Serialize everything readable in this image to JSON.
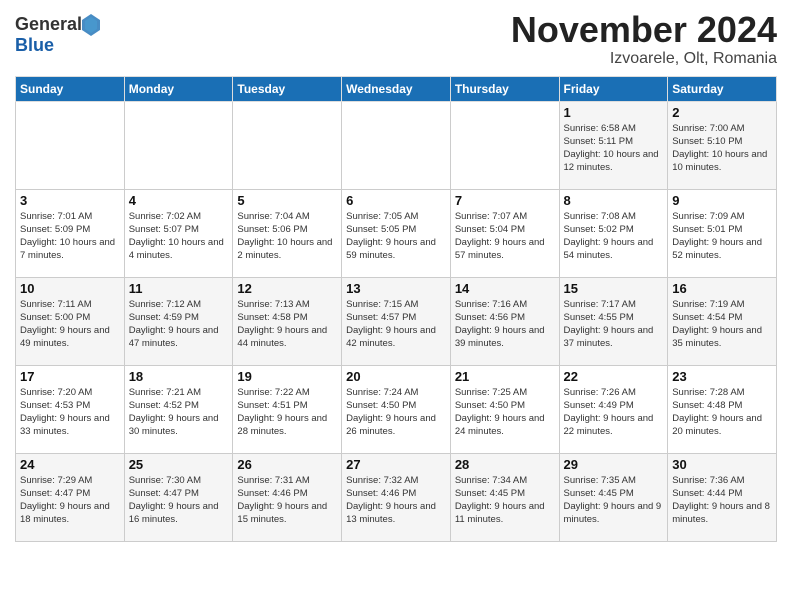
{
  "header": {
    "logo_line1": "General",
    "logo_line2": "Blue",
    "month": "November 2024",
    "location": "Izvoarele, Olt, Romania"
  },
  "weekdays": [
    "Sunday",
    "Monday",
    "Tuesday",
    "Wednesday",
    "Thursday",
    "Friday",
    "Saturday"
  ],
  "weeks": [
    [
      {
        "day": "",
        "info": ""
      },
      {
        "day": "",
        "info": ""
      },
      {
        "day": "",
        "info": ""
      },
      {
        "day": "",
        "info": ""
      },
      {
        "day": "",
        "info": ""
      },
      {
        "day": "1",
        "info": "Sunrise: 6:58 AM\nSunset: 5:11 PM\nDaylight: 10 hours\nand 12 minutes."
      },
      {
        "day": "2",
        "info": "Sunrise: 7:00 AM\nSunset: 5:10 PM\nDaylight: 10 hours\nand 10 minutes."
      }
    ],
    [
      {
        "day": "3",
        "info": "Sunrise: 7:01 AM\nSunset: 5:09 PM\nDaylight: 10 hours\nand 7 minutes."
      },
      {
        "day": "4",
        "info": "Sunrise: 7:02 AM\nSunset: 5:07 PM\nDaylight: 10 hours\nand 4 minutes."
      },
      {
        "day": "5",
        "info": "Sunrise: 7:04 AM\nSunset: 5:06 PM\nDaylight: 10 hours\nand 2 minutes."
      },
      {
        "day": "6",
        "info": "Sunrise: 7:05 AM\nSunset: 5:05 PM\nDaylight: 9 hours\nand 59 minutes."
      },
      {
        "day": "7",
        "info": "Sunrise: 7:07 AM\nSunset: 5:04 PM\nDaylight: 9 hours\nand 57 minutes."
      },
      {
        "day": "8",
        "info": "Sunrise: 7:08 AM\nSunset: 5:02 PM\nDaylight: 9 hours\nand 54 minutes."
      },
      {
        "day": "9",
        "info": "Sunrise: 7:09 AM\nSunset: 5:01 PM\nDaylight: 9 hours\nand 52 minutes."
      }
    ],
    [
      {
        "day": "10",
        "info": "Sunrise: 7:11 AM\nSunset: 5:00 PM\nDaylight: 9 hours\nand 49 minutes."
      },
      {
        "day": "11",
        "info": "Sunrise: 7:12 AM\nSunset: 4:59 PM\nDaylight: 9 hours\nand 47 minutes."
      },
      {
        "day": "12",
        "info": "Sunrise: 7:13 AM\nSunset: 4:58 PM\nDaylight: 9 hours\nand 44 minutes."
      },
      {
        "day": "13",
        "info": "Sunrise: 7:15 AM\nSunset: 4:57 PM\nDaylight: 9 hours\nand 42 minutes."
      },
      {
        "day": "14",
        "info": "Sunrise: 7:16 AM\nSunset: 4:56 PM\nDaylight: 9 hours\nand 39 minutes."
      },
      {
        "day": "15",
        "info": "Sunrise: 7:17 AM\nSunset: 4:55 PM\nDaylight: 9 hours\nand 37 minutes."
      },
      {
        "day": "16",
        "info": "Sunrise: 7:19 AM\nSunset: 4:54 PM\nDaylight: 9 hours\nand 35 minutes."
      }
    ],
    [
      {
        "day": "17",
        "info": "Sunrise: 7:20 AM\nSunset: 4:53 PM\nDaylight: 9 hours\nand 33 minutes."
      },
      {
        "day": "18",
        "info": "Sunrise: 7:21 AM\nSunset: 4:52 PM\nDaylight: 9 hours\nand 30 minutes."
      },
      {
        "day": "19",
        "info": "Sunrise: 7:22 AM\nSunset: 4:51 PM\nDaylight: 9 hours\nand 28 minutes."
      },
      {
        "day": "20",
        "info": "Sunrise: 7:24 AM\nSunset: 4:50 PM\nDaylight: 9 hours\nand 26 minutes."
      },
      {
        "day": "21",
        "info": "Sunrise: 7:25 AM\nSunset: 4:50 PM\nDaylight: 9 hours\nand 24 minutes."
      },
      {
        "day": "22",
        "info": "Sunrise: 7:26 AM\nSunset: 4:49 PM\nDaylight: 9 hours\nand 22 minutes."
      },
      {
        "day": "23",
        "info": "Sunrise: 7:28 AM\nSunset: 4:48 PM\nDaylight: 9 hours\nand 20 minutes."
      }
    ],
    [
      {
        "day": "24",
        "info": "Sunrise: 7:29 AM\nSunset: 4:47 PM\nDaylight: 9 hours\nand 18 minutes."
      },
      {
        "day": "25",
        "info": "Sunrise: 7:30 AM\nSunset: 4:47 PM\nDaylight: 9 hours\nand 16 minutes."
      },
      {
        "day": "26",
        "info": "Sunrise: 7:31 AM\nSunset: 4:46 PM\nDaylight: 9 hours\nand 15 minutes."
      },
      {
        "day": "27",
        "info": "Sunrise: 7:32 AM\nSunset: 4:46 PM\nDaylight: 9 hours\nand 13 minutes."
      },
      {
        "day": "28",
        "info": "Sunrise: 7:34 AM\nSunset: 4:45 PM\nDaylight: 9 hours\nand 11 minutes."
      },
      {
        "day": "29",
        "info": "Sunrise: 7:35 AM\nSunset: 4:45 PM\nDaylight: 9 hours\nand 9 minutes."
      },
      {
        "day": "30",
        "info": "Sunrise: 7:36 AM\nSunset: 4:44 PM\nDaylight: 9 hours\nand 8 minutes."
      }
    ]
  ]
}
